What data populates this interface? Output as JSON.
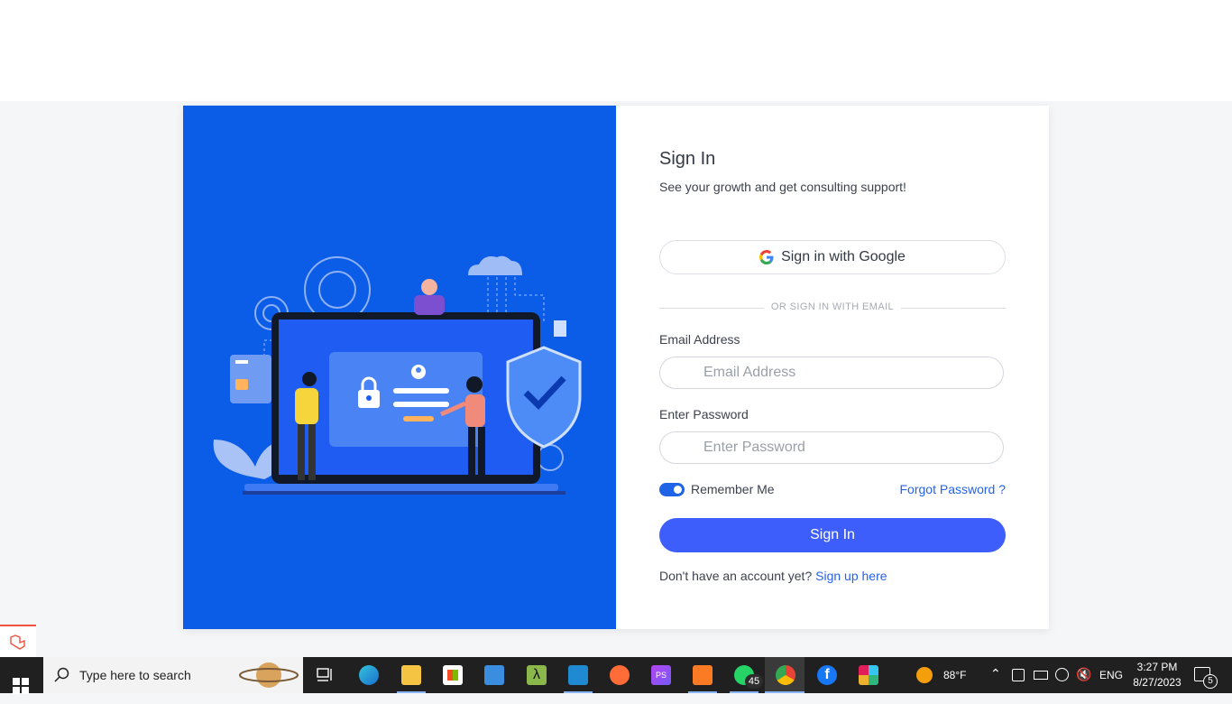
{
  "signin": {
    "title": "Sign In",
    "subtitle": "See your growth and get consulting support!",
    "google_button": "Sign in with Google",
    "divider": "OR SIGN IN WITH EMAIL",
    "email_label": "Email Address",
    "email_placeholder": "Email Address",
    "password_label": "Enter Password",
    "password_placeholder": "Enter Password",
    "remember_label": "Remember Me",
    "remember_checked": true,
    "forgot_link": "Forgot Password ?",
    "submit_button": "Sign In",
    "signup_prompt": "Don't have an account yet?",
    "signup_link": "Sign up here"
  },
  "colors": {
    "left_panel": "#0b5ce6",
    "primary_button": "#3d5efa",
    "link": "#2563eb",
    "toggle": "#1f64e6"
  },
  "taskbar": {
    "search_placeholder": "Type here to search",
    "whatsapp_badge": "45",
    "weather_temp": "88°F",
    "language": "ENG",
    "time": "3:27 PM",
    "date": "8/27/2023",
    "notification_count": "5",
    "apps": [
      "task-view",
      "edge",
      "file-explorer",
      "microsoft-store",
      "mail",
      "terminal",
      "vscode",
      "postman",
      "phpstorm",
      "xampp",
      "whatsapp",
      "chrome",
      "facebook",
      "slack"
    ]
  }
}
